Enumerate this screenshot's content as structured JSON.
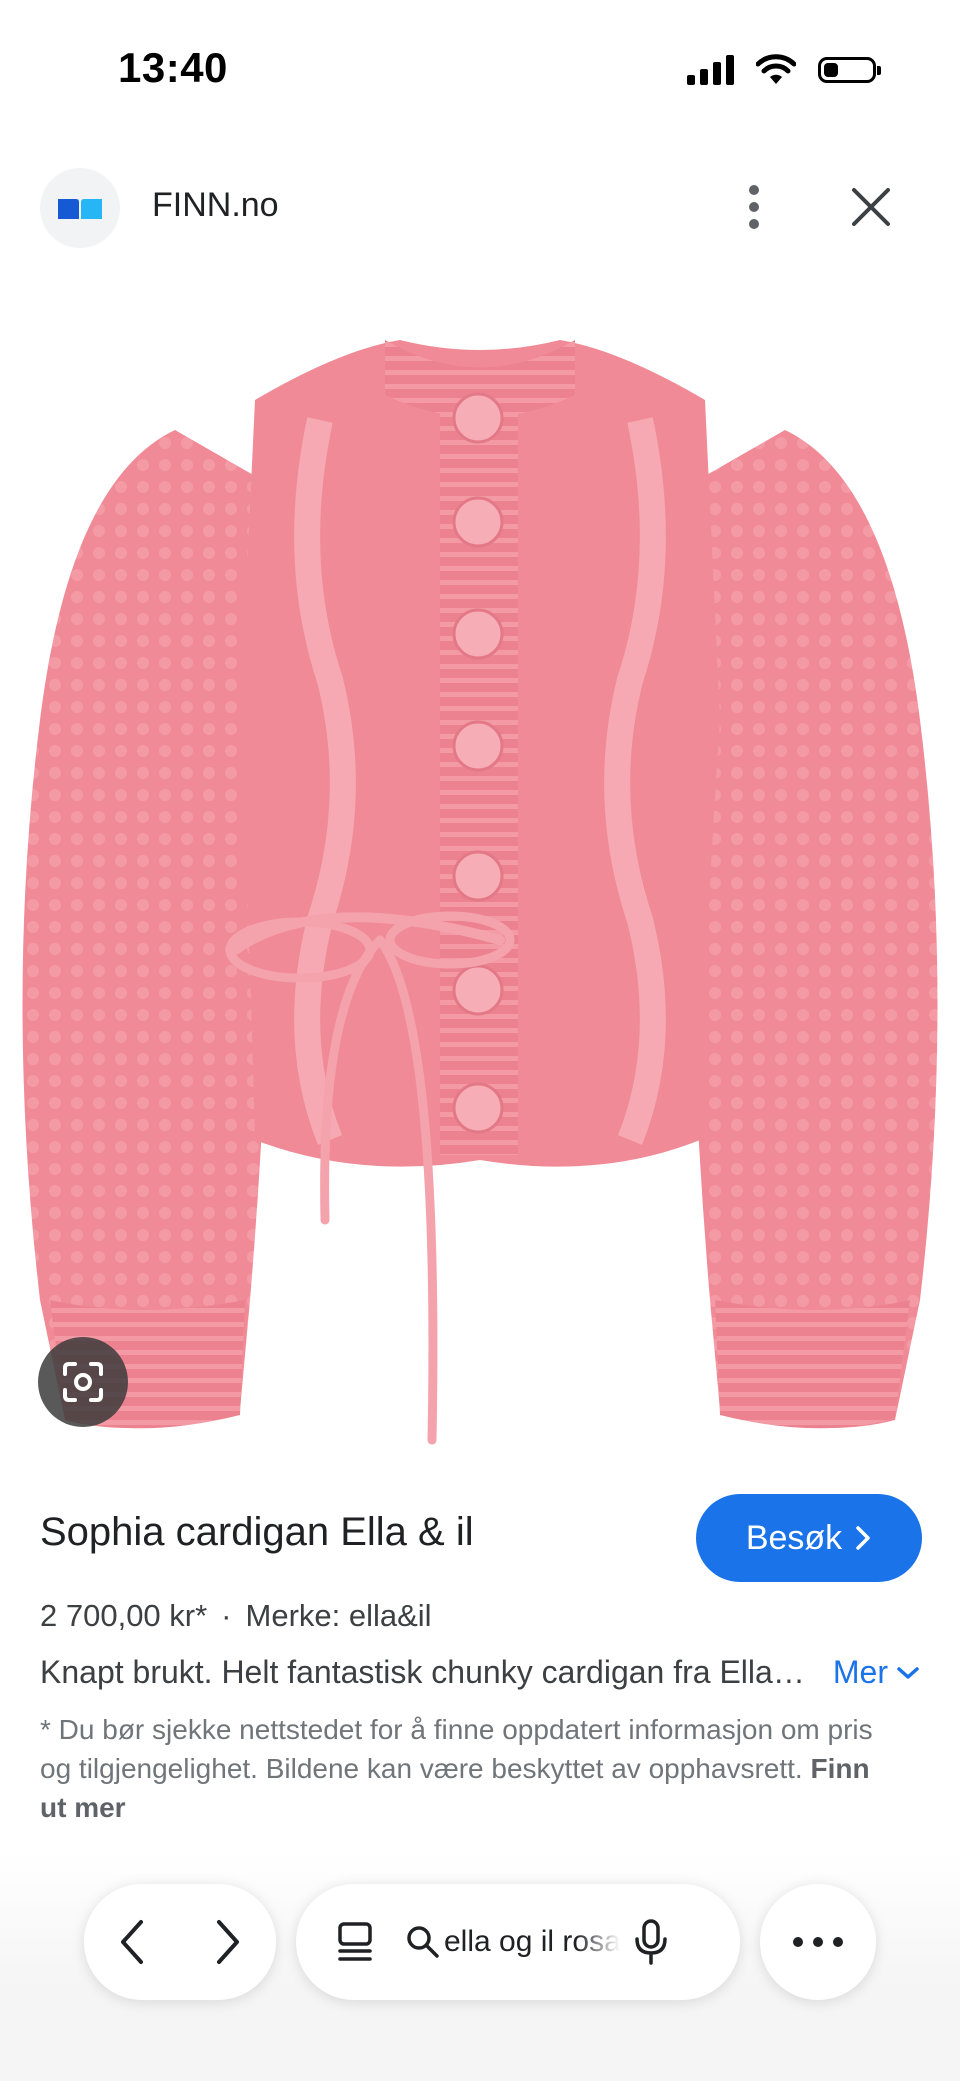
{
  "status_bar": {
    "time": "13:40"
  },
  "header": {
    "site_name": "FINN.no"
  },
  "product": {
    "title": "Sophia cardigan Ella & il",
    "visit_label": "Besøk",
    "price": "2 700,00 kr*",
    "separator": "·",
    "brand": "Merke: ella&il",
    "description": "Knapt brukt. Helt fantastisk chunky cardigan fra Ella & il",
    "more_label": "Mer",
    "disclaimer": "* Du bør sjekke nettstedet for å finne oppdatert informasjon om pris og tilgjengelighet. Bildene kan være beskyttet av opphavsrett.",
    "disclaimer_link": "Finn ut mer"
  },
  "toolbar": {
    "search_query": "ella og il rosa"
  },
  "colors": {
    "accent": "#1a73e8",
    "cardigan": "#f08a96",
    "logo_blue_dark": "#1559d4",
    "logo_blue_light": "#26b6f5"
  },
  "icons": [
    "signal-icon",
    "wifi-icon",
    "battery-icon",
    "finn-logo-icon",
    "more-vert-icon",
    "close-icon",
    "lens-icon",
    "chevron-right-icon",
    "chevron-down-icon",
    "back-icon",
    "forward-icon",
    "tabs-icon",
    "search-icon",
    "mic-icon",
    "more-horiz-icon"
  ]
}
